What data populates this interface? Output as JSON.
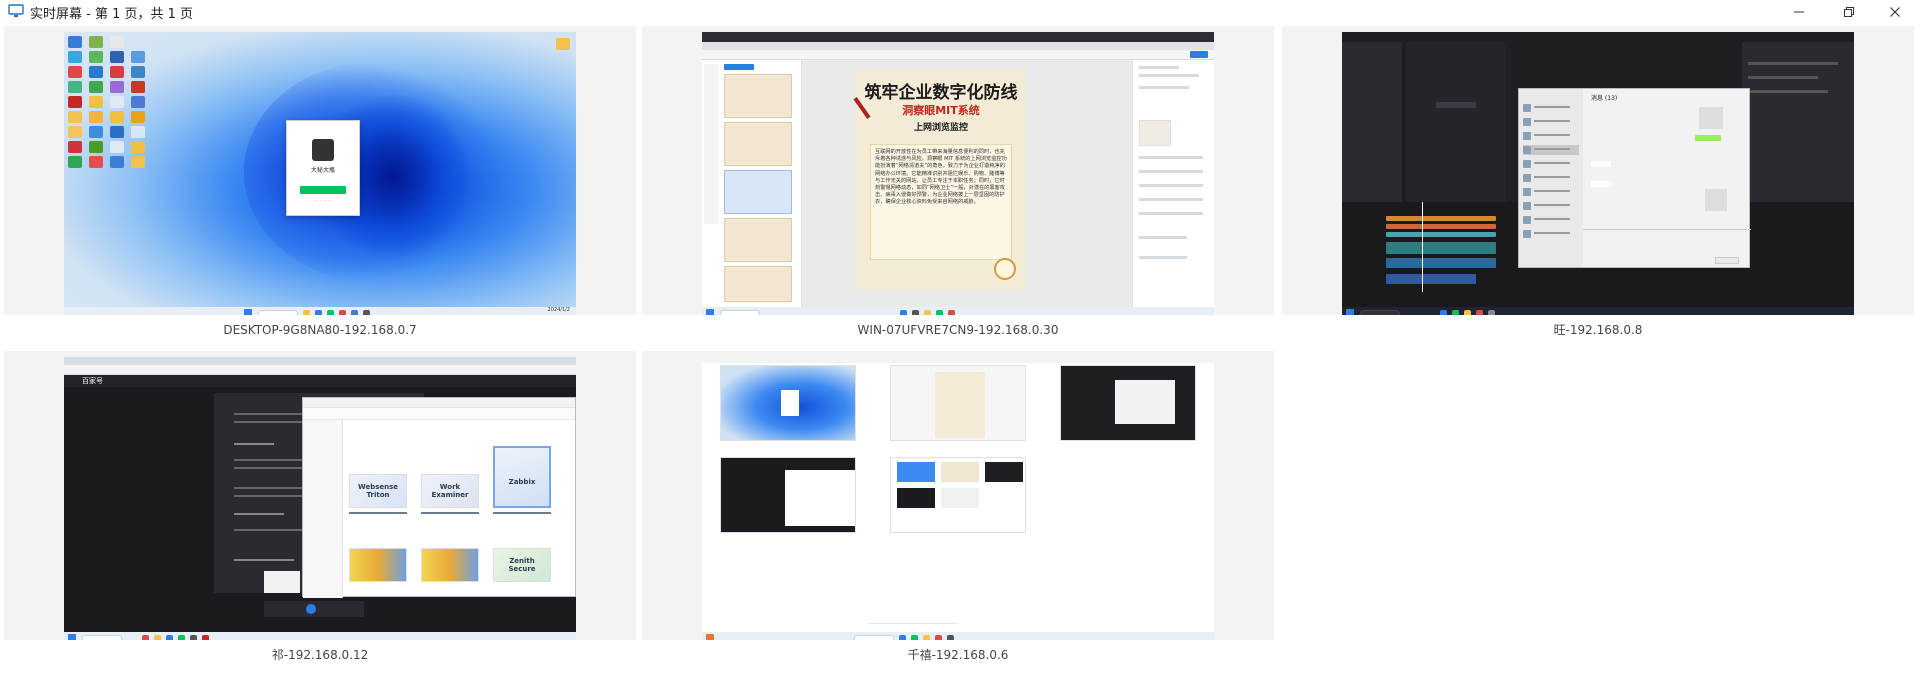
{
  "window": {
    "title": "实时屏幕 - 第 1 页，共 1 页",
    "controls": {
      "minimize": "minimize-icon",
      "restore": "restore-icon",
      "close": "close-icon"
    }
  },
  "screens": [
    {
      "label": "DESKTOP-9G8NA80-192.168.0.7",
      "dialog_name": "大秘大瓶",
      "taskbar_time": "2024/1/2"
    },
    {
      "label": "WIN-07UFVRE7CN9-192.168.0.30",
      "poster": {
        "title": "筑牢企业数字化防线",
        "subtitle": "洞察眼MIT系统",
        "section": "上网浏览监控",
        "body": "互联网的开放性在为员工带来海量信息便利的同时，也充斥着各种诱惑与风险。洞察眼 MIT 系统的上网浏览监控功能扮演着“网络清道夫”的角色，致力于为企业打造纯净的网络办公环境。它能精准识别并阻拦娱乐、购物、赌博等与工作无关的网站，让员工专注于本职任务；同时，它时刻警惕网络动态，如同“网络卫士”一般，对潜在的黑客攻击、病毒入侵做好预警，为企业网络披上一层坚固的防护衣，确保企业核心资料免受来自网络的威胁。"
      }
    },
    {
      "label": "旺-192.168.0.8",
      "chat_title": "消息 (13)"
    },
    {
      "label": "祁-192.168.0.12",
      "app_name": "百家号",
      "cards": [
        "Websense Triton",
        "Work Examiner",
        "Zabbix",
        "Zenith Secure"
      ]
    },
    {
      "label": "千禧-192.168.0.6"
    }
  ],
  "colors": {
    "accent": "#2b7de9",
    "wechat_green": "#07c160",
    "poster_red": "#c0271a"
  }
}
